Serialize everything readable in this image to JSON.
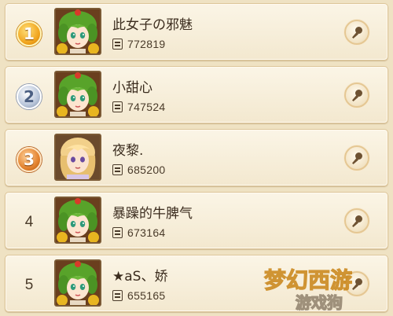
{
  "rows": [
    {
      "rank": "1",
      "medal": "r1",
      "name": "此女子の邪魅",
      "score": "772819",
      "avatar": "green"
    },
    {
      "rank": "2",
      "medal": "r2",
      "name": "小甜心",
      "score": "747524",
      "avatar": "green"
    },
    {
      "rank": "3",
      "medal": "r3",
      "name": "夜黎.",
      "score": "685200",
      "avatar": "blonde"
    },
    {
      "rank": "4",
      "medal": "",
      "name": "暴躁的牛脾气",
      "score": "673164",
      "avatar": "green"
    },
    {
      "rank": "5",
      "medal": "",
      "name": "★aS、娇",
      "score": "655165",
      "avatar": "green"
    }
  ],
  "icons": {
    "score": "document-icon",
    "action": "microphone-icon"
  },
  "watermark": {
    "text": "梦幻西游",
    "site": "游戏狗"
  },
  "colors": {
    "panel": "#f7eedb",
    "border": "#ddc69a",
    "text": "#3b2c1e"
  }
}
